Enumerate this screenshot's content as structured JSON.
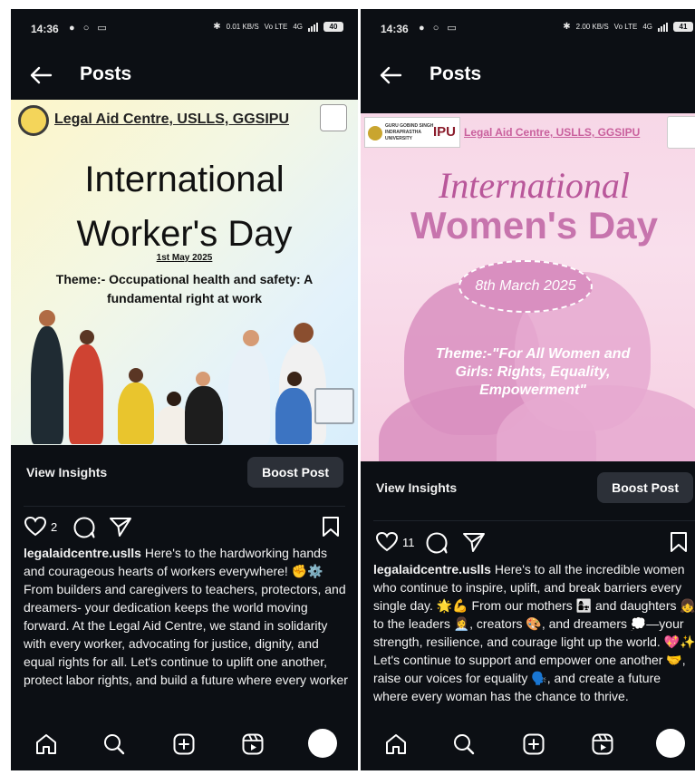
{
  "screens": [
    {
      "status": {
        "time": "14:36",
        "net_speed": "0.01 KB/S",
        "net_type": "Vo LTE",
        "sig": "4G",
        "battery": "40"
      },
      "header": {
        "title": "Posts"
      },
      "post": {
        "org_name": "Legal Aid Centre, USLLS, GGSIPU",
        "headline_line1": "International",
        "headline_line2": "Worker's Day",
        "date": "1st May 2025",
        "theme": "Theme:- Occupational health and safety: A fundamental right at work"
      },
      "insights": {
        "view_label": "View Insights",
        "boost_label": "Boost Post"
      },
      "actions": {
        "likes": "2"
      },
      "caption": {
        "username": "legalaidcentre.uslls",
        "text": " Here's to the hardworking hands and courageous hearts of workers everywhere! ✊⚙️\nFrom builders and caregivers to teachers, protectors, and dreamers- your dedication keeps the world moving forward. At the Legal Aid Centre, we stand in solidarity with every worker, advocating for justice, dignity, and equal rights for all. Let's continue to uplift one another, protect labor rights, and build a future where every worker"
      }
    },
    {
      "status": {
        "time": "14:36",
        "net_speed": "2.00 KB/S",
        "net_type": "Vo LTE",
        "sig": "4G",
        "battery": "41"
      },
      "header": {
        "title": "Posts"
      },
      "post": {
        "org_name": "Legal Aid Centre, USLLS, GGSIPU",
        "univ_name": "GURU GOBIND SINGH INDRAPRASTHA UNIVERSITY",
        "headline_line1": "International",
        "headline_line2": "Women's Day",
        "date": "8th March 2025",
        "theme": "Theme:-\"For All Women and Girls: Rights, Equality, Empowerment\""
      },
      "insights": {
        "view_label": "View Insights",
        "boost_label": "Boost Post"
      },
      "actions": {
        "likes": "11"
      },
      "caption": {
        "username": "legalaidcentre.uslls",
        "text": " Here's to all the incredible women who continue to inspire, uplift, and break barriers every single day. 🌟💪 From our mothers 👩‍👧 and daughters 👧 to the leaders 👩‍💼, creators 🎨, and dreamers 💭—your strength, resilience, and courage light up the world. 💖✨ Let's continue to support and empower one another 🤝, raise our voices for equality 🗣️, and create a future where every woman has the chance to thrive."
      }
    }
  ],
  "colors": {
    "bg": "#0c0f14",
    "button": "#2c3038",
    "women_pink": "#c9609d",
    "women_headline": "#b9579a"
  },
  "icons": [
    "back-arrow-icon",
    "heart-icon",
    "comment-icon",
    "share-icon",
    "bookmark-icon",
    "home-icon",
    "search-icon",
    "create-icon",
    "reels-icon",
    "profile-avatar"
  ]
}
